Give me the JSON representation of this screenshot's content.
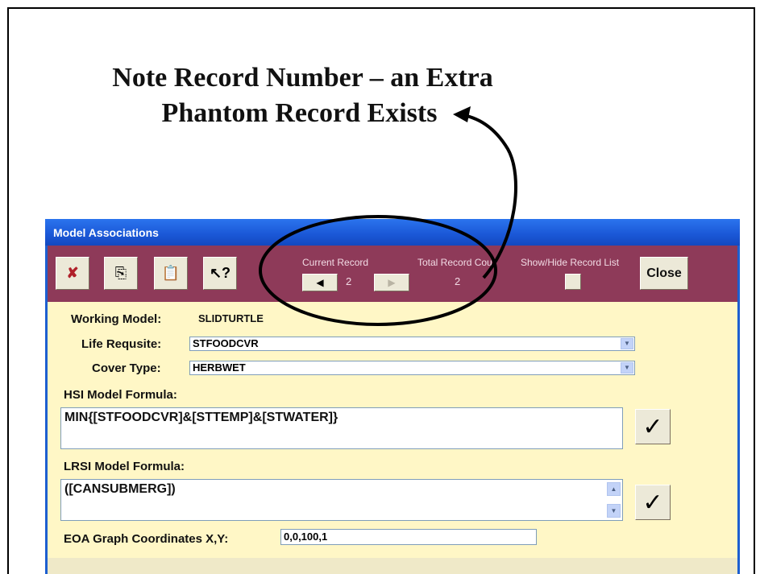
{
  "annotation": {
    "line1": "Note Record Number – an Extra",
    "line2": "Phantom Record Exists"
  },
  "window": {
    "title": "Model Associations"
  },
  "toolbar": {
    "current_record_label": "Current Record",
    "current_record_value": "2",
    "total_record_label": "Total Record Count",
    "total_record_value": "2",
    "show_hide_label": "Show/Hide Record List",
    "close_label": "Close",
    "delete_icon": "delete-record-icon",
    "copy_icon": "copy-icon",
    "paste_icon": "paste-icon",
    "help_icon": "whats-this-help-icon"
  },
  "form": {
    "working_model_label": "Working Model:",
    "working_model_value": "SLIDTURTLE",
    "life_requisite_label": "Life Requsite:",
    "life_requisite_value": "STFOODCVR",
    "cover_type_label": "Cover Type:",
    "cover_type_value": "HERBWET",
    "hsi_label": "HSI Model Formula:",
    "hsi_value": "MIN{[STFOODCVR]&[STTEMP]&[STWATER]}",
    "lrsi_label": "LRSI Model Formula:",
    "lrsi_value": "([CANSUBMERG])",
    "eoa_label": "EOA Graph Coordinates X,Y:",
    "eoa_value": "0,0,100,1"
  },
  "colors": {
    "titlebar": "#1a57d6",
    "toolbar": "#8e3a59",
    "form_bg": "#fff7c6"
  }
}
